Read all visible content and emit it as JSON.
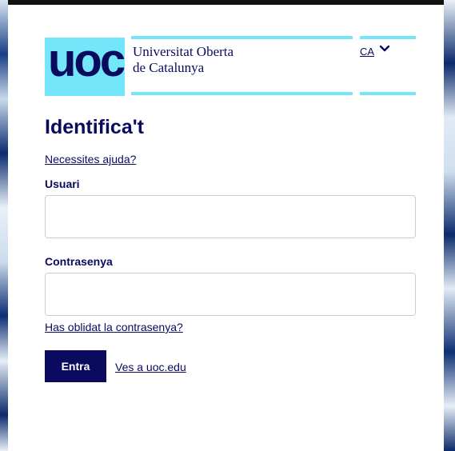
{
  "header": {
    "logo_text": "uoc",
    "university_line1": "Universitat Oberta",
    "university_line2": "de Catalunya",
    "language": "CA"
  },
  "form": {
    "title": "Identifica't",
    "help_link": "Necessites ajuda?",
    "user_label": "Usuari",
    "user_value": "",
    "password_label": "Contrasenya",
    "password_value": "",
    "forgot_link": "Has oblidat la contrasenya?",
    "submit_label": "Entra",
    "goto_link": "Ves a uoc.edu"
  },
  "colors": {
    "brand_navy": "#0a0a5e",
    "brand_cyan": "#73e6f9"
  }
}
